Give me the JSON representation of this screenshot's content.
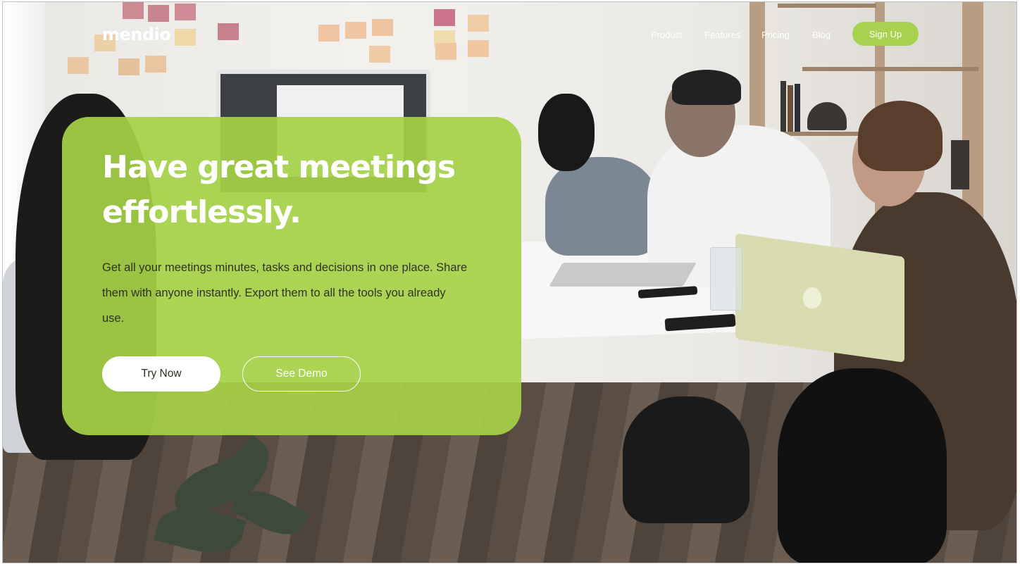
{
  "brand": {
    "logo": "mendio",
    "accent_color": "#a7d14f",
    "text_color": "#ffffff"
  },
  "nav": {
    "links": [
      {
        "label": "Product"
      },
      {
        "label": "Features"
      },
      {
        "label": "Pricing"
      },
      {
        "label": "Blog"
      }
    ],
    "signup_label": "Sign Up"
  },
  "hero": {
    "title": "Have great meetings effortlessly.",
    "description": "Get all your meetings minutes, tasks and decisions in one place. Share them with anyone instantly. Export them to all the tools you already use.",
    "primary_cta": "Try Now",
    "secondary_cta": "See Demo",
    "card_color": "#a6d146"
  },
  "background": {
    "subject": "team-meeting-photo"
  }
}
